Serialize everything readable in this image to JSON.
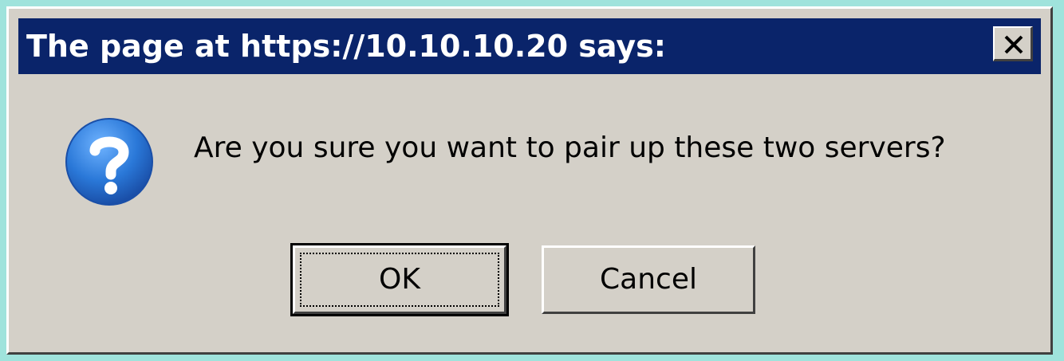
{
  "dialog": {
    "title": "The page at https://10.10.10.20 says:",
    "message": "Are you sure you want to pair up these two servers?",
    "icon": "question-icon",
    "buttons": {
      "ok_label": "OK",
      "cancel_label": "Cancel"
    },
    "colors": {
      "titlebar": "#0a246a",
      "dialog_bg": "#d4d0c8",
      "page_bg": "#9fe3dc",
      "icon_blue": "#2a78d8"
    }
  }
}
